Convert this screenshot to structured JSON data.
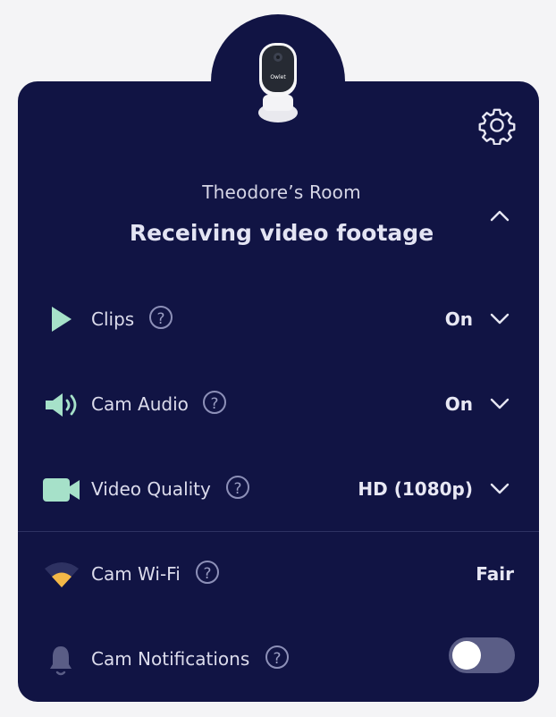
{
  "device": {
    "room_name": "Theodore’s Room",
    "status": "Receiving video footage",
    "camera_brand": "Owlet"
  },
  "settings": [
    {
      "label": "Clips",
      "value": "On",
      "icon": "play-icon"
    },
    {
      "label": "Cam Audio",
      "value": "On",
      "icon": "speaker-icon"
    },
    {
      "label": "Video Quality",
      "value": "HD (1080p)",
      "icon": "video-camera-icon"
    }
  ],
  "status_rows": [
    {
      "label": "Cam Wi-Fi",
      "value": "Fair",
      "icon": "wifi-icon"
    },
    {
      "label": "Cam Notifications",
      "icon": "bell-icon",
      "toggle_on": false
    }
  ],
  "help_glyph": "?",
  "colors": {
    "card_bg": "#111444",
    "accent_green": "#a6e1c9",
    "wifi_yellow": "#f4b847",
    "toggle_off": "#5a5d86"
  }
}
